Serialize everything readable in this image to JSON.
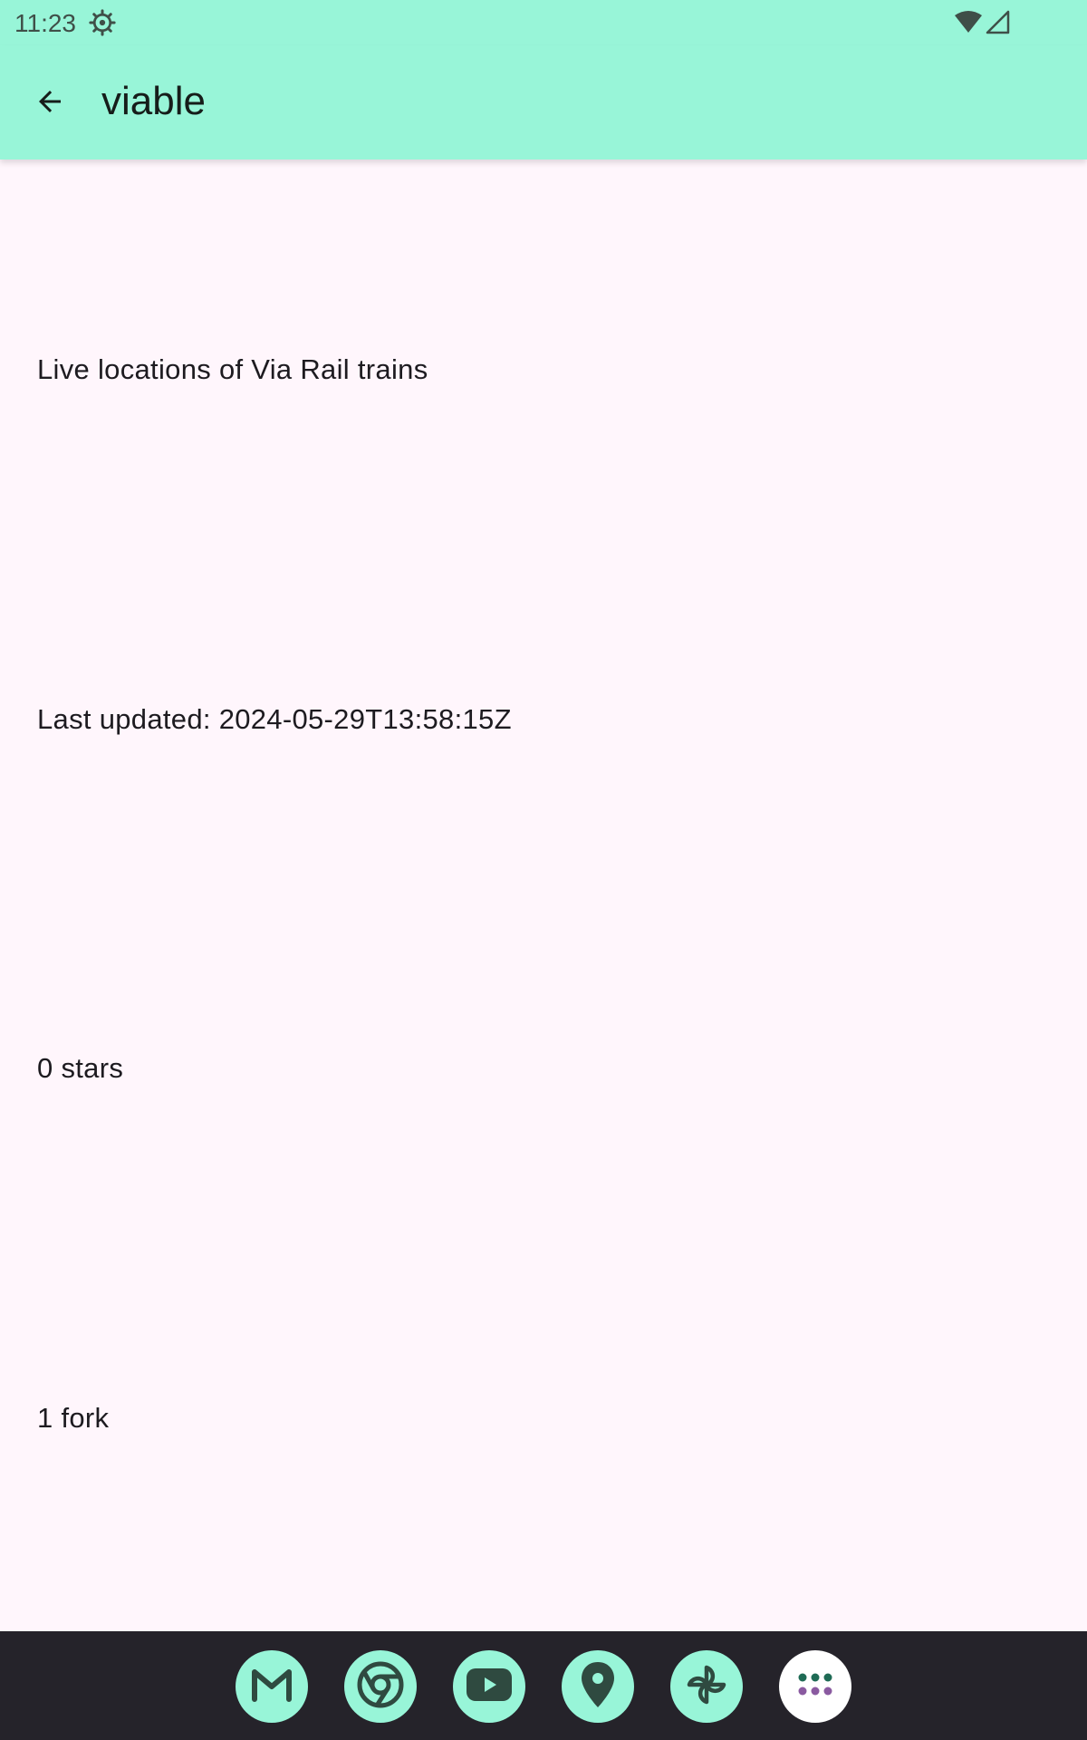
{
  "status_bar": {
    "time": "11:23",
    "icons": [
      "settings-gear-icon",
      "wifi-icon",
      "cell-signal-icon"
    ]
  },
  "app_bar": {
    "back_icon": "arrow-back-icon",
    "title": "viable"
  },
  "details": {
    "description": "Live locations of Via Rail trains",
    "last_updated": "Last updated: 2024-05-29T13:58:15Z",
    "stars": "0 stars",
    "forks": "1 fork"
  },
  "dock": {
    "apps": [
      "gmail-icon",
      "chrome-icon",
      "youtube-icon",
      "maps-icon",
      "photos-icon",
      "app-drawer-icon"
    ]
  },
  "colors": {
    "accent": "#98f5d8",
    "background": "#fff6fc",
    "dock_background": "#25232a",
    "icon_glyph": "#2f4a40"
  }
}
